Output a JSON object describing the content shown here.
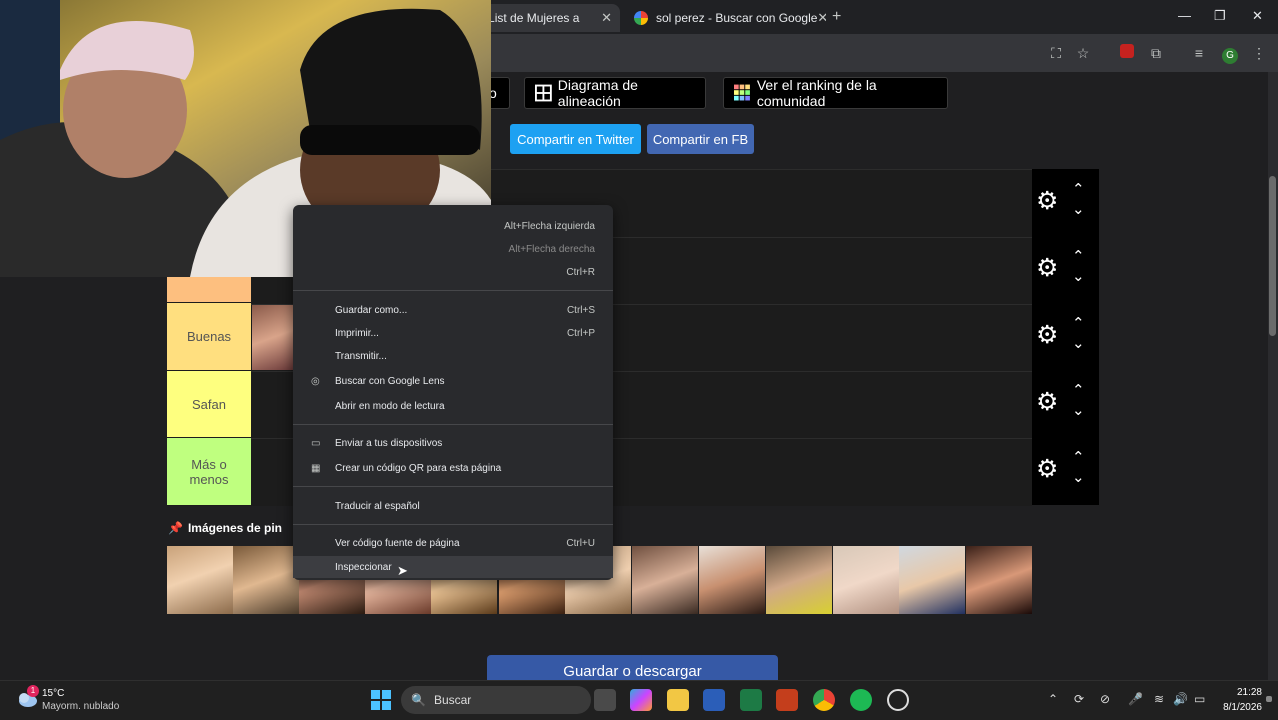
{
  "browser": {
    "tabs": [
      {
        "title": "na Tier List de Mujeres a",
        "active": true
      },
      {
        "title": "sol perez - Buscar con Google",
        "active": false
      }
    ],
    "new_tab": "+",
    "window_controls": {
      "minimize": "—",
      "maximize": "❐",
      "close": "✕"
    },
    "profile_initial": "G"
  },
  "page": {
    "buttons": {
      "partial": "o",
      "alignment": "Diagrama de alineación",
      "ranking": "Ver el ranking de la comunidad",
      "share_twitter": "Compartir en Twitter",
      "share_fb": "Compartir en FB"
    },
    "tiers": [
      {
        "label": "",
        "color": "#fdbf7f"
      },
      {
        "label": "",
        "color": "#ffdf7f"
      },
      {
        "label": "Buenas",
        "color": "#ffdf7f"
      },
      {
        "label": "Safan",
        "color": "#feff7f"
      },
      {
        "label": "Más o menos",
        "color": "#bfff7f"
      }
    ],
    "pin_images_title": "Imágenes de pin",
    "save_button": "Guardar o descargar",
    "colors": {
      "twitter": "#1da1f2",
      "facebook": "#4267b2",
      "save": "#3659a6"
    }
  },
  "context_menu": {
    "items": [
      {
        "label": "",
        "shortcut": "Alt+Flecha izquierda",
        "disabled": false
      },
      {
        "label": "",
        "shortcut": "Alt+Flecha derecha",
        "disabled": true
      },
      {
        "label": "",
        "shortcut": "Ctrl+R",
        "disabled": false
      },
      {
        "label": "Guardar como...",
        "shortcut": "Ctrl+S"
      },
      {
        "label": "Imprimir...",
        "shortcut": "Ctrl+P"
      },
      {
        "label": "Transmitir...",
        "shortcut": ""
      },
      {
        "label": "Buscar con Google Lens",
        "shortcut": "",
        "icon": "lens-icon"
      },
      {
        "label": "Abrir en modo de lectura",
        "shortcut": ""
      },
      {
        "label": "Enviar a tus dispositivos",
        "shortcut": "",
        "icon": "devices-icon"
      },
      {
        "label": "Crear un código QR para esta página",
        "shortcut": "",
        "icon": "qr-icon"
      },
      {
        "label": "Traducir al español",
        "shortcut": ""
      },
      {
        "label": "Ver código fuente de página",
        "shortcut": "Ctrl+U"
      },
      {
        "label": "Inspeccionar",
        "shortcut": ""
      }
    ]
  },
  "taskbar": {
    "weather_temp": "15°C",
    "weather_desc": "Mayorm. nublado",
    "weather_badge": "1",
    "search_placeholder": "Buscar",
    "time": "21:28",
    "date": "8/1/2026"
  }
}
